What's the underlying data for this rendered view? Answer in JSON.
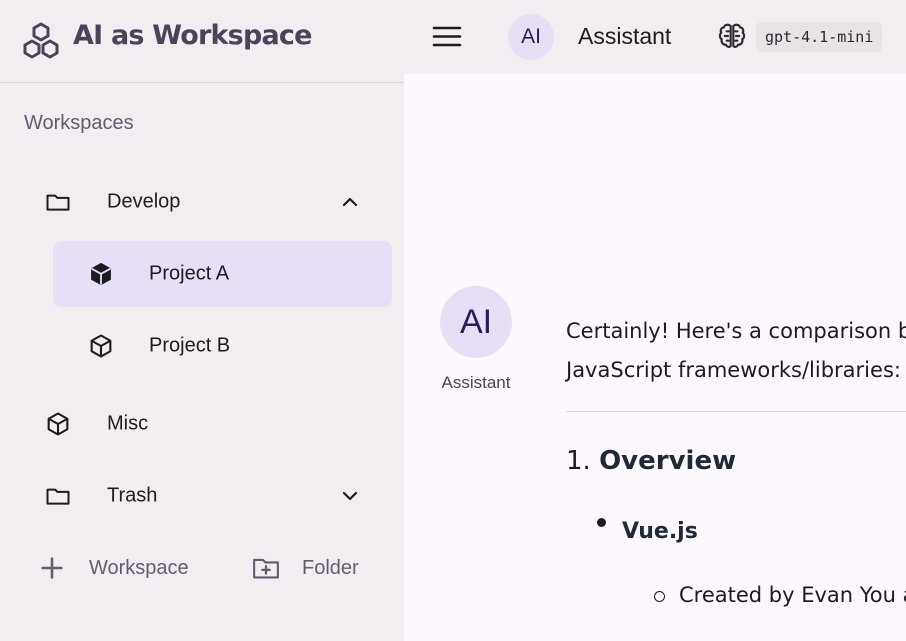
{
  "brand": {
    "title": "AI as Workspace",
    "logo_icon": "hexagon-cluster-icon"
  },
  "sidebar": {
    "section_label": "Workspaces",
    "items": [
      {
        "label": "Develop",
        "icon": "folder-icon",
        "chevron": "chevron-up-icon",
        "expanded": true
      },
      {
        "label": "Project A",
        "icon": "cube-filled-icon",
        "active": true
      },
      {
        "label": "Project B",
        "icon": "cube-outline-icon"
      },
      {
        "label": "Misc",
        "icon": "cube-outline-icon"
      },
      {
        "label": "Trash",
        "icon": "folder-icon",
        "chevron": "chevron-down-icon",
        "expanded": false
      }
    ],
    "add_workspace_label": "Workspace",
    "add_folder_label": "Folder"
  },
  "topbar": {
    "avatar_initials": "AI",
    "title": "Assistant",
    "model": "gpt-4.1-mini"
  },
  "chat": {
    "sender_initials": "AI",
    "sender_name": "Assistant",
    "message_lines": [
      "Certainly! Here's a comparison b",
      "JavaScript frameworks/libraries:"
    ],
    "heading_number": "1.",
    "heading_text": "Overview",
    "bullet_1": "Vue.js",
    "sub_bullet_1": "Created by Evan You a"
  },
  "colors": {
    "sidebar_bg": "#f3edf2",
    "content_bg": "#fdf7fe",
    "active_item_bg": "#e7dff5",
    "avatar_bg": "#e7dff5",
    "brand_text": "#4a4458"
  }
}
